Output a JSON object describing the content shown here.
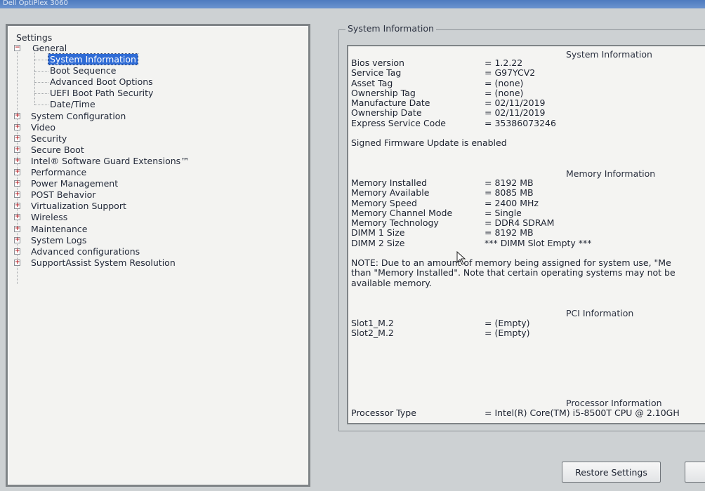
{
  "window": {
    "title": "Dell OptiPlex 3060"
  },
  "tree": {
    "root_label": "Settings",
    "general": {
      "label": "General",
      "children": [
        {
          "label": "System Information",
          "selected": true
        },
        {
          "label": "Boot Sequence"
        },
        {
          "label": "Advanced Boot Options"
        },
        {
          "label": "UEFI Boot Path Security"
        },
        {
          "label": "Date/Time"
        }
      ]
    },
    "categories": [
      {
        "label": "System Configuration"
      },
      {
        "label": "Video"
      },
      {
        "label": "Security"
      },
      {
        "label": "Secure Boot"
      },
      {
        "label": "Intel® Software Guard Extensions™"
      },
      {
        "label": "Performance"
      },
      {
        "label": "Power Management"
      },
      {
        "label": "POST Behavior"
      },
      {
        "label": "Virtualization Support"
      },
      {
        "label": "Wireless"
      },
      {
        "label": "Maintenance"
      },
      {
        "label": "System Logs"
      },
      {
        "label": "Advanced configurations"
      },
      {
        "label": "SupportAssist System Resolution"
      }
    ]
  },
  "info": {
    "group_title": "System Information",
    "system": {
      "title": "System Information",
      "rows": [
        {
          "key": "Bios version",
          "value": "= 1.2.22"
        },
        {
          "key": "Service Tag",
          "value": "= G97YCV2"
        },
        {
          "key": "Asset Tag",
          "value": "= (none)"
        },
        {
          "key": "Ownership Tag",
          "value": "= (none)"
        },
        {
          "key": "Manufacture Date",
          "value": "= 02/11/2019"
        },
        {
          "key": "Ownership Date",
          "value": "= 02/11/2019"
        },
        {
          "key": "Express Service Code",
          "value": "= 35386073246"
        }
      ],
      "firmware_note": "Signed Firmware Update is enabled"
    },
    "memory": {
      "title": "Memory Information",
      "rows": [
        {
          "key": "Memory Installed",
          "value": "= 8192 MB"
        },
        {
          "key": "Memory Available",
          "value": "= 8085 MB"
        },
        {
          "key": "Memory Speed",
          "value": "= 2400 MHz"
        },
        {
          "key": "Memory Channel Mode",
          "value": "= Single"
        },
        {
          "key": "Memory Technology",
          "value": "= DDR4 SDRAM"
        },
        {
          "key": "DIMM 1 Size",
          "value": "= 8192 MB"
        },
        {
          "key": "DIMM 2 Size",
          "value": "*** DIMM Slot Empty ***"
        }
      ],
      "note_lines": [
        "NOTE: Due to an amount of memory being assigned for system use, \"Me",
        "than \"Memory Installed\". Note that certain operating systems may not be",
        "available memory."
      ]
    },
    "pci": {
      "title": "PCI Information",
      "rows": [
        {
          "key": "Slot1_M.2",
          "value": "= (Empty)"
        },
        {
          "key": "Slot2_M.2",
          "value": "= (Empty)"
        }
      ]
    },
    "processor": {
      "title": "Processor Information",
      "rows": [
        {
          "key": "Processor Type",
          "value": "= Intel(R) Core(TM) i5-8500T CPU @ 2.10GH"
        }
      ]
    }
  },
  "buttons": {
    "restore": "Restore Settings"
  },
  "colors": {
    "selection": "#2e6bd6",
    "panel_bg": "#f3f3f1",
    "expander_mark": "#b8262b"
  }
}
